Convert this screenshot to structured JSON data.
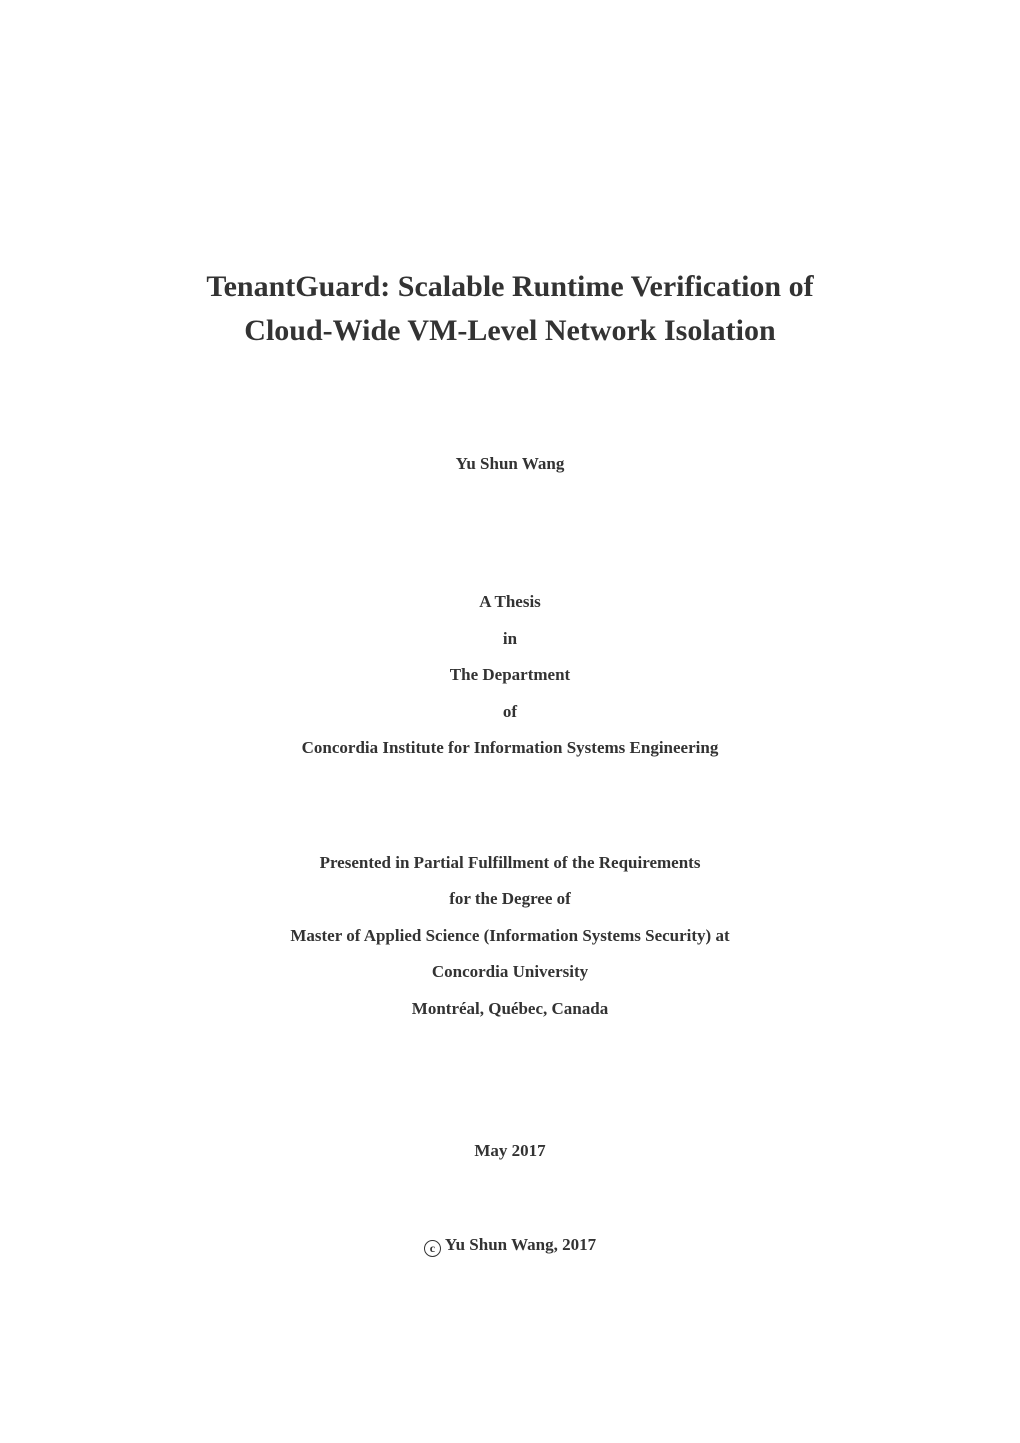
{
  "title": {
    "line1": "TenantGuard: Scalable Runtime Verification of",
    "line2": "Cloud-Wide VM-Level Network Isolation"
  },
  "author": "Yu Shun Wang",
  "thesis_block": {
    "line1": "A Thesis",
    "line2": "in",
    "line3": "The Department",
    "line4": "of",
    "line5": "Concordia Institute for Information Systems Engineering"
  },
  "fulfillment_block": {
    "line1": "Presented in Partial Fulfillment of the Requirements",
    "line2": "for the Degree of",
    "line3": "Master of Applied Science (Information Systems Security) at",
    "line4": "Concordia University",
    "line5": "Montréal, Québec, Canada"
  },
  "date": "May 2017",
  "copyright": {
    "symbol": "c",
    "text": "Yu Shun Wang, 2017"
  }
}
